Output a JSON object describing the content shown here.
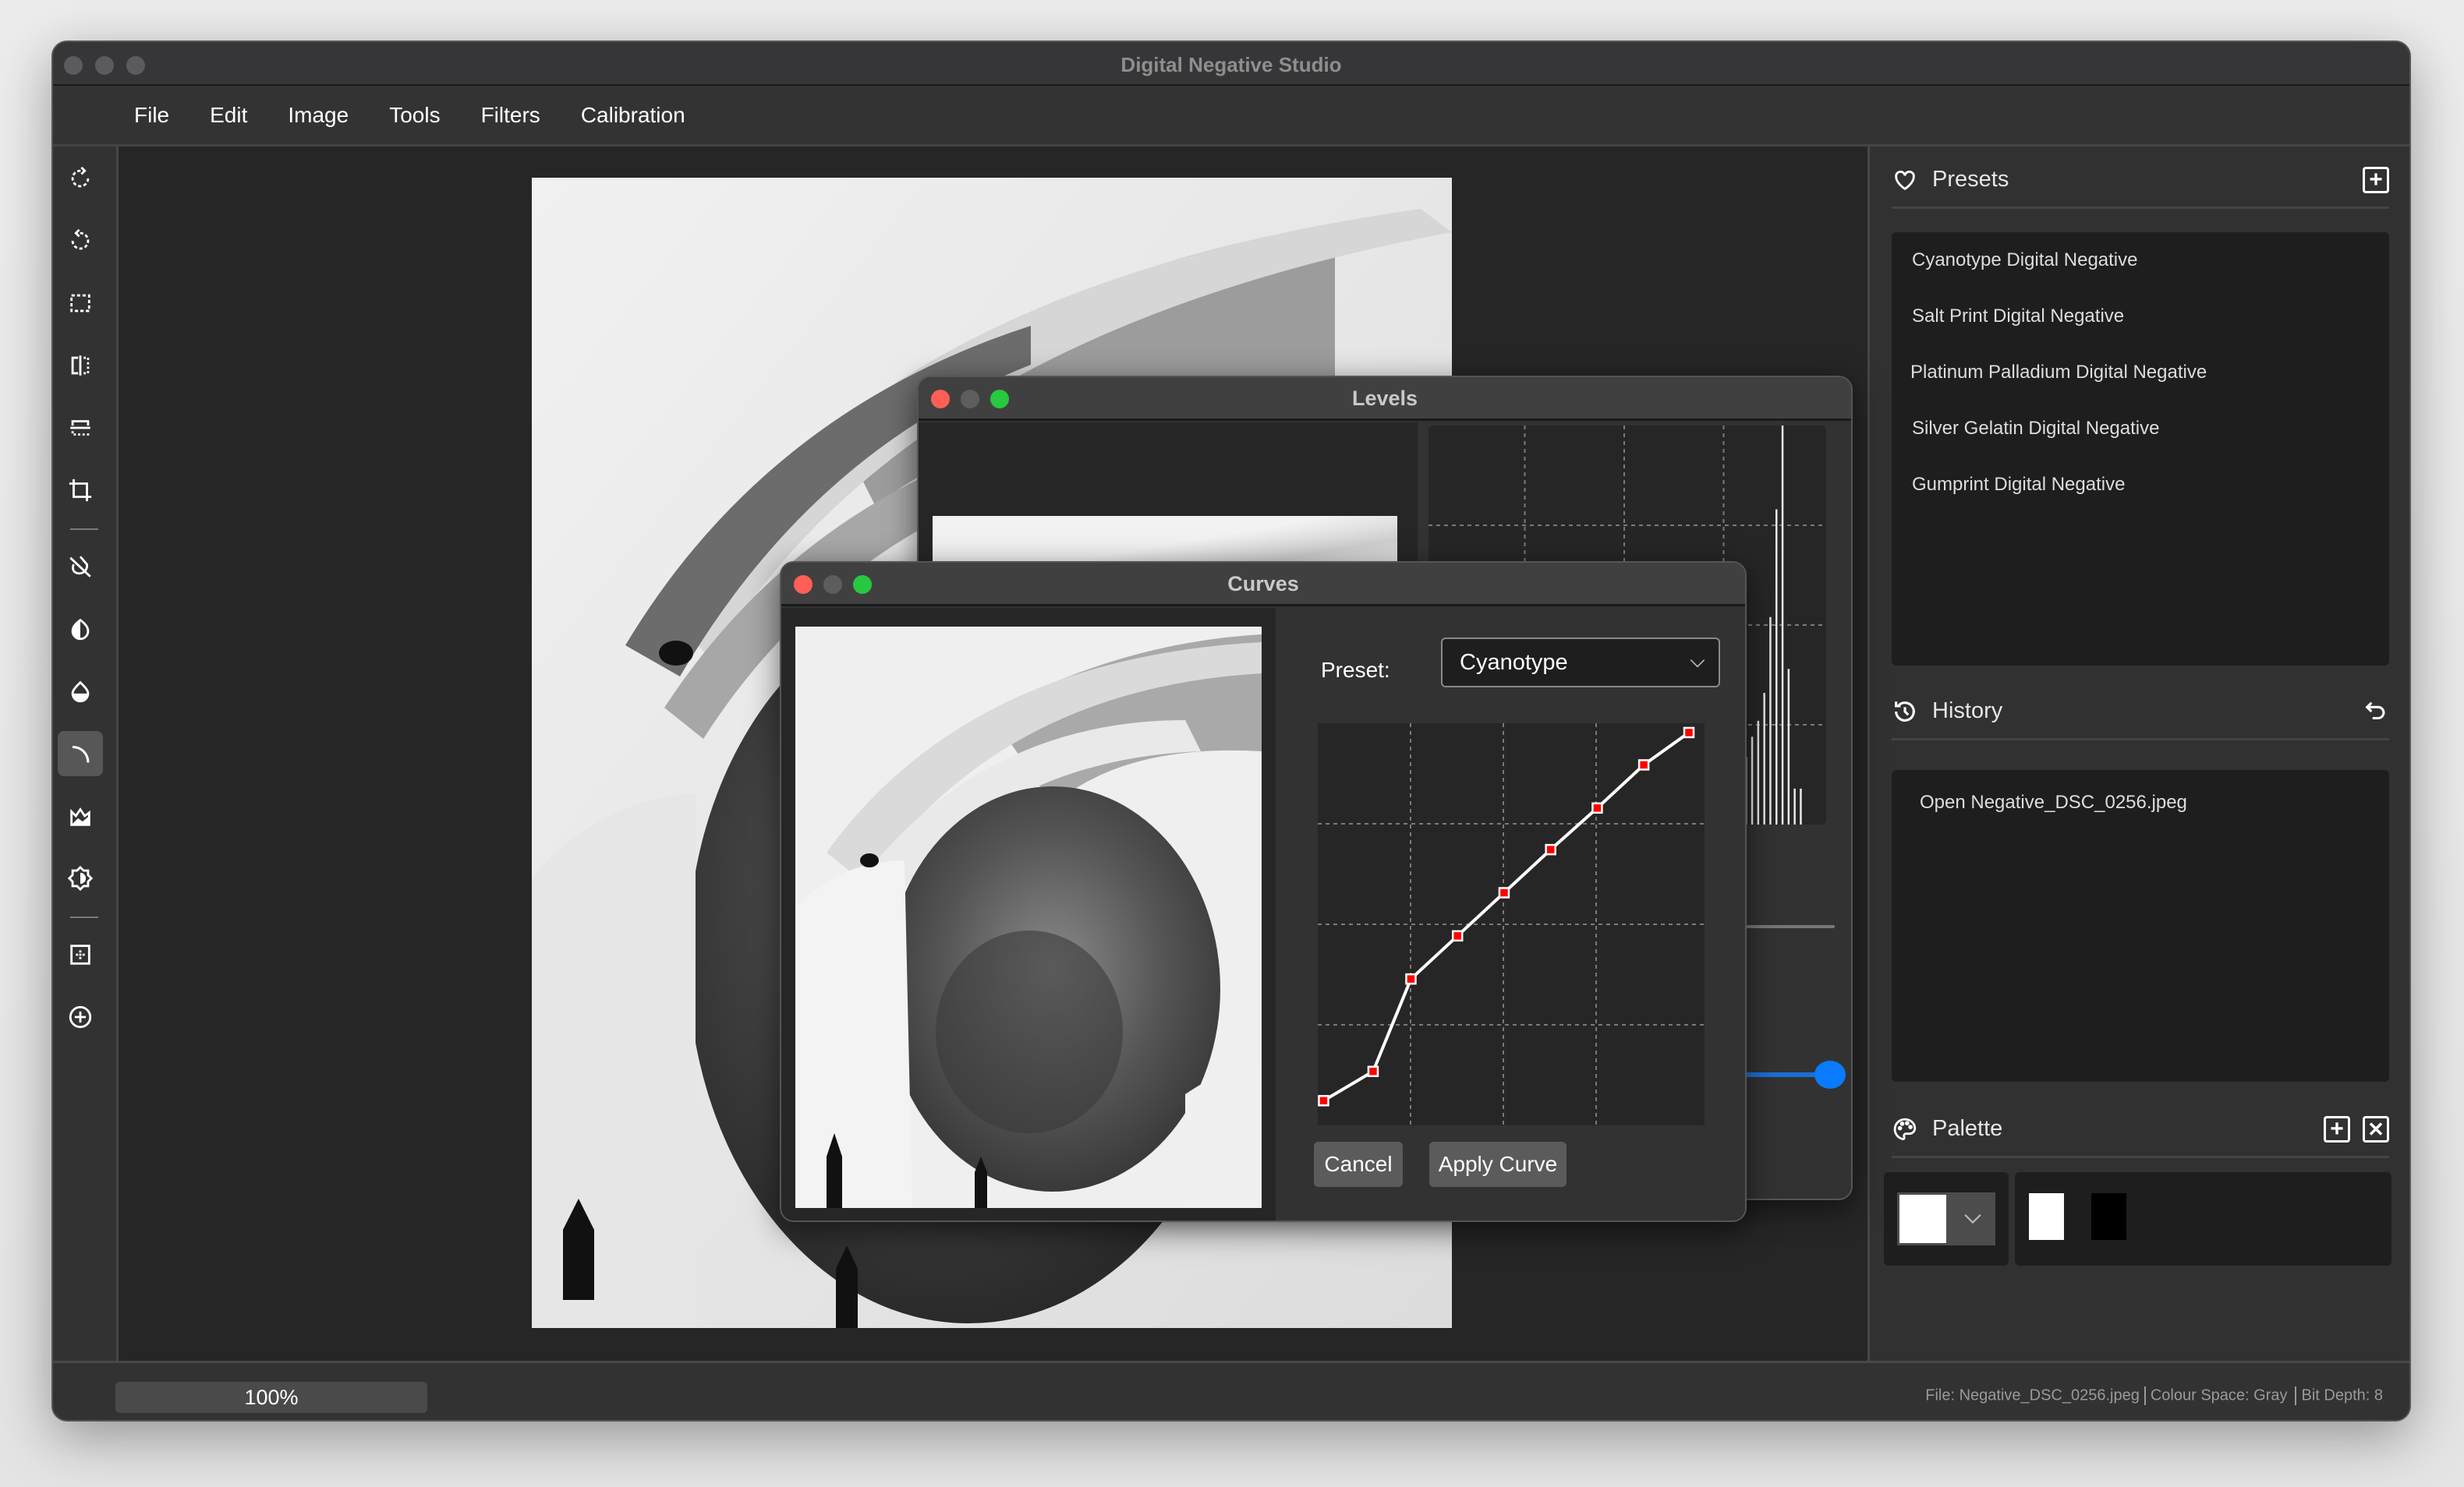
{
  "window": {
    "title": "Digital Negative Studio"
  },
  "menu": [
    "File",
    "Edit",
    "Image",
    "Tools",
    "Filters",
    "Calibration"
  ],
  "toolbar": {
    "tools": [
      {
        "name": "rotate-clockwise",
        "active": false
      },
      {
        "name": "rotate-counterclockwise",
        "active": false
      },
      {
        "name": "marquee-select",
        "active": false
      },
      {
        "name": "flip-horizontal",
        "active": false
      },
      {
        "name": "flip-vertical",
        "active": false
      },
      {
        "name": "crop",
        "active": false
      },
      {
        "name": "invert",
        "active": false
      },
      {
        "name": "contrast",
        "active": false
      },
      {
        "name": "tint",
        "active": false
      },
      {
        "name": "curves",
        "active": true
      },
      {
        "name": "levels",
        "active": false
      },
      {
        "name": "brightness",
        "active": false
      },
      {
        "name": "calibration-grid",
        "active": false
      },
      {
        "name": "add",
        "active": false
      }
    ]
  },
  "presets": {
    "title": "Presets",
    "items": [
      "Cyanotype Digital Negative",
      "Salt Print Digital Negative",
      "Platinum Palladium Digital Negative",
      "Silver Gelatin Digital Negative",
      "Gumprint Digital Negative"
    ]
  },
  "history": {
    "title": "History",
    "items": [
      "Open Negative_DSC_0256.jpeg"
    ]
  },
  "palette": {
    "title": "Palette",
    "current_color": "#ffffff",
    "swatches": [
      "#ffffff",
      "#000000"
    ]
  },
  "status": {
    "zoom": "100%",
    "file": "File: Negative_DSC_0256.jpeg",
    "colour_space": "Colour Space: Gray",
    "bit_depth": "Bit Depth: 8"
  },
  "levels_dialog": {
    "title": "Levels",
    "histogram": [
      17,
      22,
      26,
      33,
      52,
      79,
      100,
      39,
      9,
      9
    ],
    "slider_value": 1.0
  },
  "curves_dialog": {
    "title": "Curves",
    "preset_label": "Preset:",
    "preset_value": "Cyanotype",
    "cancel_label": "Cancel",
    "apply_label": "Apply Curve",
    "curve_points": [
      [
        4,
        13
      ],
      [
        38,
        32
      ],
      [
        64,
        92
      ],
      [
        96,
        120
      ],
      [
        128,
        148
      ],
      [
        160,
        176
      ],
      [
        192,
        203
      ],
      [
        224,
        231
      ],
      [
        255,
        252
      ]
    ],
    "axis_max": 255
  }
}
